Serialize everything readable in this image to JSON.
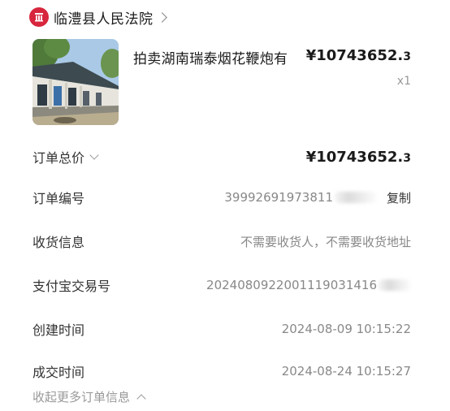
{
  "shop": {
    "name": "临澧县人民法院"
  },
  "product": {
    "title": "拍卖湖南瑞泰烟花鞭炮有",
    "price_main": "¥10743652.",
    "price_decimal": "3",
    "quantity": "x1"
  },
  "details": {
    "total": {
      "label": "订单总价",
      "value_main": "¥10743652.",
      "value_decimal": "3"
    },
    "order_no": {
      "label": "订单编号",
      "value": "39992691973811",
      "copy_label": "复制"
    },
    "shipping": {
      "label": "收货信息",
      "value": "不需要收货人，不需要收货地址"
    },
    "alipay_no": {
      "label": "支付宝交易号",
      "value": "2024080922001119031416"
    },
    "created": {
      "label": "创建时间",
      "value": "2024-08-09 10:15:22"
    },
    "deal": {
      "label": "成交时间",
      "value": "2024-08-24 10:15:27"
    },
    "collapse_label": "收起更多订单信息"
  },
  "colors": {
    "logo": "#d7263d",
    "text_primary": "#1a1a1a",
    "text_secondary": "#888888"
  },
  "icons": {
    "shop_logo": "court-emblem-icon",
    "shop_chevron": "chevron-right-icon",
    "total_caret": "chevron-down-icon",
    "collapse_caret": "chevron-up-icon"
  }
}
